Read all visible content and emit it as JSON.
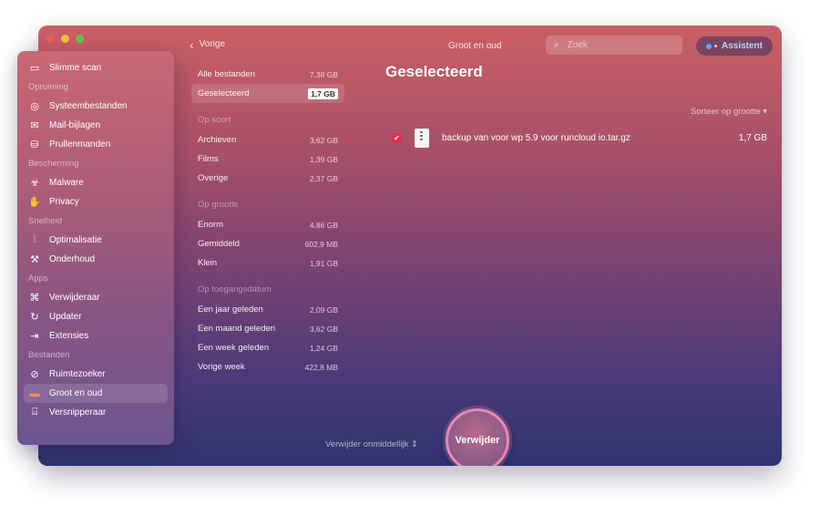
{
  "window": {
    "title": "Groot en oud",
    "back_label": "Vorige",
    "search_placeholder": "Zoek",
    "assistant_label": "Assistent"
  },
  "sidebar": {
    "top_item": {
      "label": "Slimme scan",
      "icon": "scan-icon"
    },
    "sections": [
      {
        "title": "Opruiming",
        "items": [
          {
            "label": "Systeembestanden",
            "icon": "system-files-icon"
          },
          {
            "label": "Mail-bijlagen",
            "icon": "mail-icon"
          },
          {
            "label": "Prullenmanden",
            "icon": "trash-icon"
          }
        ]
      },
      {
        "title": "Bescherming",
        "items": [
          {
            "label": "Malware",
            "icon": "biohazard-icon"
          },
          {
            "label": "Privacy",
            "icon": "hand-icon"
          }
        ]
      },
      {
        "title": "Snelheid",
        "items": [
          {
            "label": "Optimalisatie",
            "icon": "sliders-icon"
          },
          {
            "label": "Onderhoud",
            "icon": "wrench-icon"
          }
        ]
      },
      {
        "title": "Apps",
        "items": [
          {
            "label": "Verwijderaar",
            "icon": "uninstaller-icon"
          },
          {
            "label": "Updater",
            "icon": "updater-icon"
          },
          {
            "label": "Extensies",
            "icon": "extensions-icon"
          }
        ]
      },
      {
        "title": "Bestanden",
        "items": [
          {
            "label": "Ruimtezoeker",
            "icon": "space-lens-icon"
          },
          {
            "label": "Groot en oud",
            "icon": "folder-icon",
            "active": true
          },
          {
            "label": "Versnipperaar",
            "icon": "shredder-icon"
          }
        ]
      }
    ]
  },
  "categories": {
    "all": {
      "label": "Alle bestanden",
      "size": "7,38 GB"
    },
    "selected": {
      "label": "Geselecteerd",
      "size": "1,7 GB"
    },
    "groups": [
      {
        "title": "Op soort",
        "items": [
          {
            "label": "Archieven",
            "size": "3,62 GB"
          },
          {
            "label": "Films",
            "size": "1,39 GB"
          },
          {
            "label": "Overige",
            "size": "2,37 GB"
          }
        ]
      },
      {
        "title": "Op grootte",
        "items": [
          {
            "label": "Enorm",
            "size": "4,86 GB"
          },
          {
            "label": "Gemiddeld",
            "size": "602,9 MB"
          },
          {
            "label": "Klein",
            "size": "1,91 GB"
          }
        ]
      },
      {
        "title": "Op toegangsdatum",
        "items": [
          {
            "label": "Een jaar geleden",
            "size": "2,09 GB"
          },
          {
            "label": "Een maand geleden",
            "size": "3,62 GB"
          },
          {
            "label": "Een week geleden",
            "size": "1,24 GB"
          },
          {
            "label": "Vorige week",
            "size": "422,8 MB"
          }
        ]
      }
    ]
  },
  "main": {
    "title": "Geselecteerd",
    "sort_label": "Sorteer op grootte",
    "files": [
      {
        "name": "backup van voor wp 5.9 voor runcloud io.tar.gz",
        "size": "1,7 GB",
        "checked": true
      }
    ]
  },
  "footer": {
    "remove_mode_label": "Verwijder onmiddellijk",
    "remove_button_label": "Verwijder"
  },
  "colors": {
    "accent_red": "#e0304a",
    "ring_pink": "#e889b0",
    "assistant_blue": "#59a8ff"
  }
}
